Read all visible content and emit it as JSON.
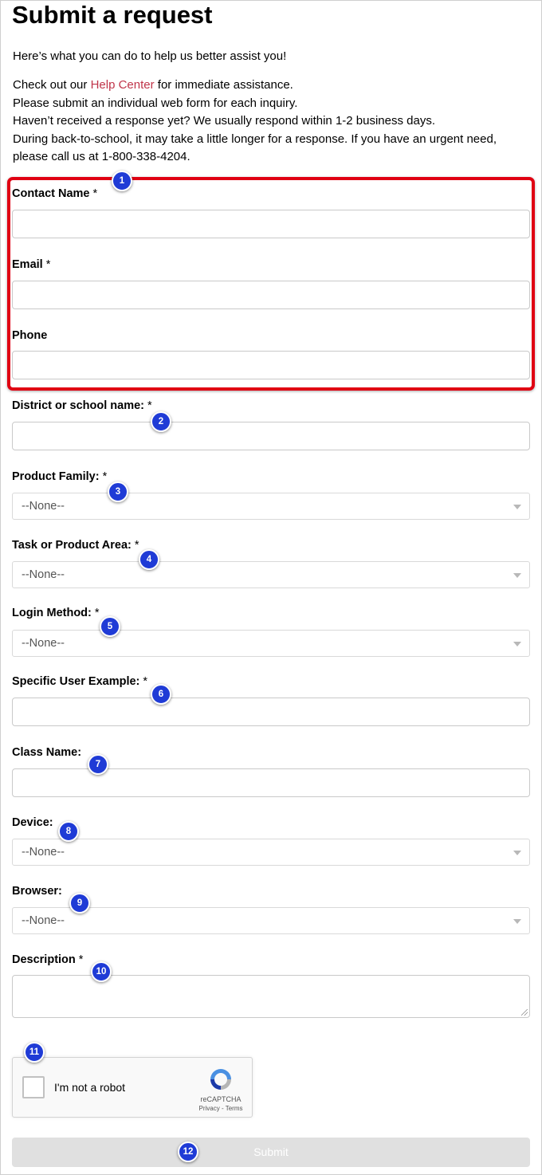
{
  "page_title": "Submit a request",
  "intro": "Here’s what you can do to help us better assist you!",
  "info": {
    "check_prefix": "Check out our ",
    "help_link": "Help Center",
    "check_suffix": " for immediate assistance.",
    "line2": "Please submit an individual web form for each inquiry.",
    "line3": "Haven’t received a response yet? We usually respond within 1-2 business days.",
    "line4": "During back-to-school, it may take a little longer for a response. If you have an urgent need,",
    "line5": "please call us at 1-800-338-4204."
  },
  "fields": {
    "contact_name": {
      "label": "Contact Name",
      "req": " *"
    },
    "email": {
      "label": "Email",
      "req": " *"
    },
    "phone": {
      "label": "Phone",
      "req": ""
    },
    "district": {
      "label": "District or school name:",
      "req": " *"
    },
    "product_family": {
      "label": "Product Family:",
      "req": " *",
      "value": "--None--"
    },
    "task_area": {
      "label": "Task or Product Area:",
      "req": " *",
      "value": "--None--"
    },
    "login_method": {
      "label": "Login Method:",
      "req": " *",
      "value": "--None--"
    },
    "user_example": {
      "label": "Specific User Example:",
      "req": " *"
    },
    "class_name": {
      "label": "Class Name:",
      "req": ""
    },
    "device": {
      "label": "Device:",
      "req": "",
      "value": "--None--"
    },
    "browser": {
      "label": "Browser:",
      "req": "",
      "value": "--None--"
    },
    "description": {
      "label": "Description",
      "req": " *"
    }
  },
  "captcha": {
    "text": "I'm not a robot",
    "brand": "reCAPTCHA",
    "links": "Privacy - Terms"
  },
  "submit_label": "Submit",
  "badges": [
    "1",
    "2",
    "3",
    "4",
    "5",
    "6",
    "7",
    "8",
    "9",
    "10",
    "11",
    "12"
  ],
  "colors": {
    "highlight": "#e00012",
    "badge": "#1f3bd6",
    "link": "#c0354a"
  }
}
